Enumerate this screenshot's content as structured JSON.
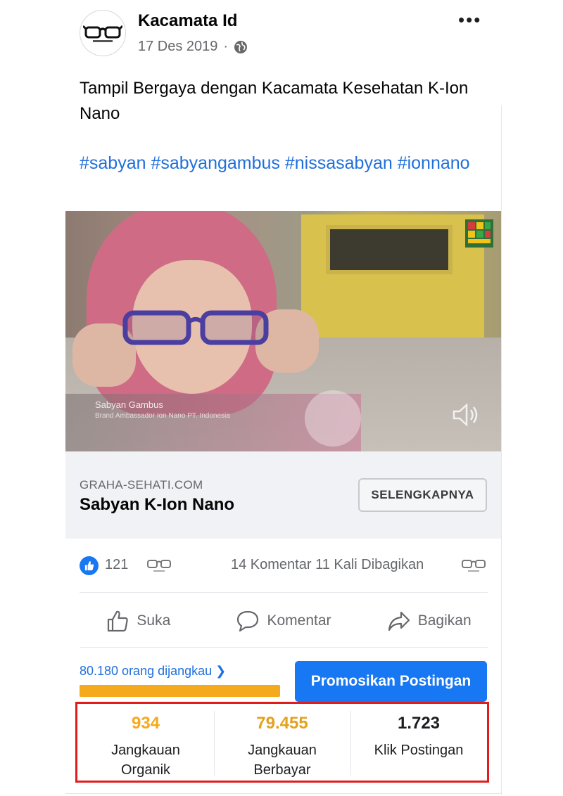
{
  "post": {
    "page_name": "Kacamata Id",
    "date": "17 Des 2019",
    "more_icon": "more-horizontal-icon",
    "text": "Tampil Bergaya dengan Kacamata Kesehatan K-Ion Nano",
    "hashtags": "#sabyan #sabyangambus #nissasabyan #ionnano",
    "avatar_icon": "glasses-logo-icon"
  },
  "video": {
    "caption_title": "Sabyan Gambus",
    "caption_sub": "Brand Ambassador Ion Nano PT. Indonesia",
    "speaker_icon": "speaker-icon"
  },
  "link": {
    "domain": "GRAHA-SEHATI.COM",
    "title": "Sabyan K-Ion Nano",
    "cta_label": "SELENGKAPNYA"
  },
  "engagement": {
    "like_count": "121",
    "comments_shares": "14 Komentar 11 Kali Dibagikan"
  },
  "actions": {
    "like": "Suka",
    "comment": "Komentar",
    "share": "Bagikan"
  },
  "promotion": {
    "reach_text": "80.180 orang dijangkau",
    "reach_fraction": 0.46,
    "promote_label": "Promosikan Postingan"
  },
  "insights": [
    {
      "value": "934",
      "label": "Jangkauan\nOrganik",
      "color": "#f5a91d"
    },
    {
      "value": "79.455",
      "label": "Jangkauan\nBerbayar",
      "color": "#e3a21d"
    },
    {
      "value": "1.723",
      "label": "Klik Postingan",
      "color": "#1c1e21"
    }
  ],
  "colors": {
    "link_blue": "#216fdb",
    "facebook_blue": "#1877f2",
    "reach_orange": "#f5a91d",
    "highlight_red": "#e21b1b"
  }
}
